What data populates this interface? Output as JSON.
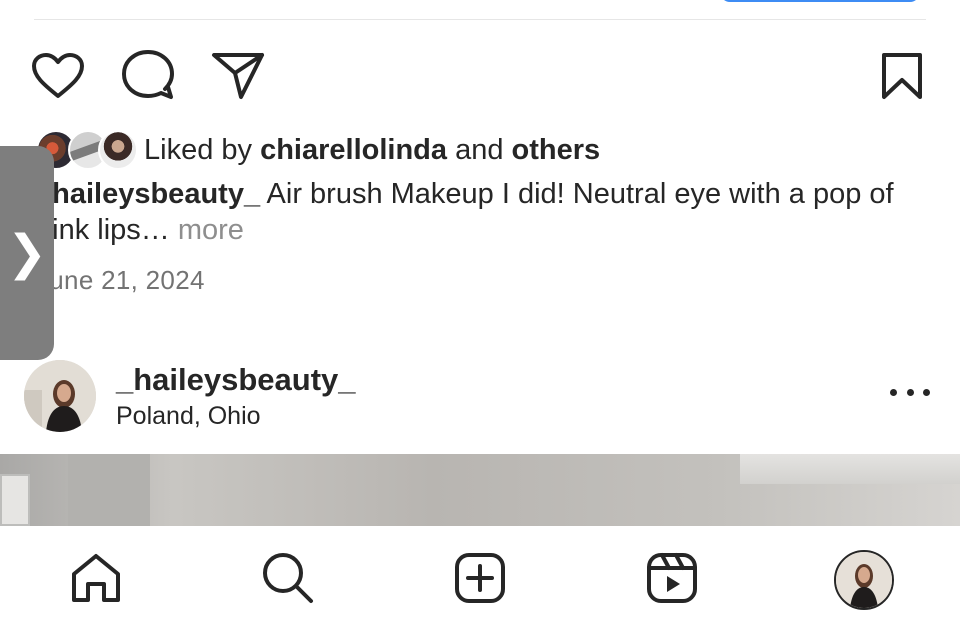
{
  "likes": {
    "prefix": "Liked by ",
    "user": "chiarellolinda",
    "middle": " and ",
    "others": "others"
  },
  "caption": {
    "username": "_haileysbeauty_",
    "text": " Air brush Makeup I did! Neutral eye with a pop of pink lips…",
    "more": " more"
  },
  "post_date": "June 21, 2024",
  "side_handle": {
    "glyph": "❯"
  },
  "next_post": {
    "username": "_haileysbeauty_",
    "location": "Poland, Ohio"
  },
  "icons": {
    "action_bar": [
      "heart-icon",
      "comment-icon",
      "share-icon",
      "bookmark-icon"
    ],
    "tab_bar": [
      "home-icon",
      "search-icon",
      "create-icon",
      "reels-icon",
      "profile-avatar"
    ]
  },
  "colors": {
    "text": "#262626",
    "secondary_text": "#8e8e8e",
    "accent_blue": "#3d8cf4",
    "handle": "#7e7e7e"
  }
}
